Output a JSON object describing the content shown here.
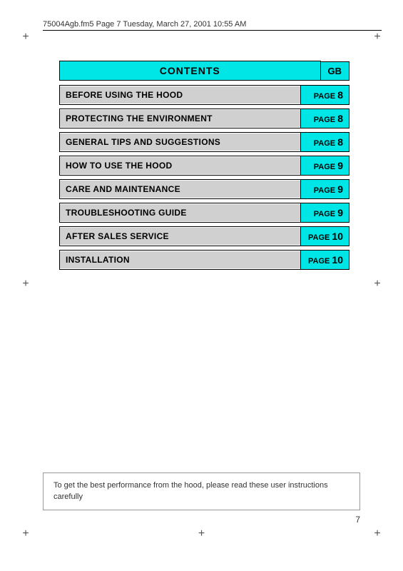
{
  "header": {
    "filename": "75004Agb.fm5  Page 7  Tuesday, March 27, 2001  10:55 AM"
  },
  "contents": {
    "title": "CONTENTS",
    "gb_label": "GB",
    "rows": [
      {
        "label": "BEFORE USING THE HOOD",
        "page_text": "PAGE",
        "page_num": "8"
      },
      {
        "label": "PROTECTING THE ENVIRONMENT",
        "page_text": "PAGE",
        "page_num": "8"
      },
      {
        "label": "GENERAL TIPS AND SUGGESTIONS",
        "page_text": "PAGE",
        "page_num": "8"
      },
      {
        "label": "HOW TO USE THE HOOD",
        "page_text": "PAGE",
        "page_num": "9"
      },
      {
        "label": "CARE AND MAINTENANCE",
        "page_text": "PAGE",
        "page_num": "9"
      },
      {
        "label": "TROUBLESHOOTING GUIDE",
        "page_text": "PAGE",
        "page_num": "9"
      },
      {
        "label": "AFTER SALES SERVICE",
        "page_text": "PAGE",
        "page_num": "10"
      },
      {
        "label": "INSTALLATION",
        "page_text": "PAGE",
        "page_num": "10"
      }
    ]
  },
  "footer": {
    "note": "To get the best performance from the hood, please read these user instructions carefully"
  },
  "page_number": "7"
}
